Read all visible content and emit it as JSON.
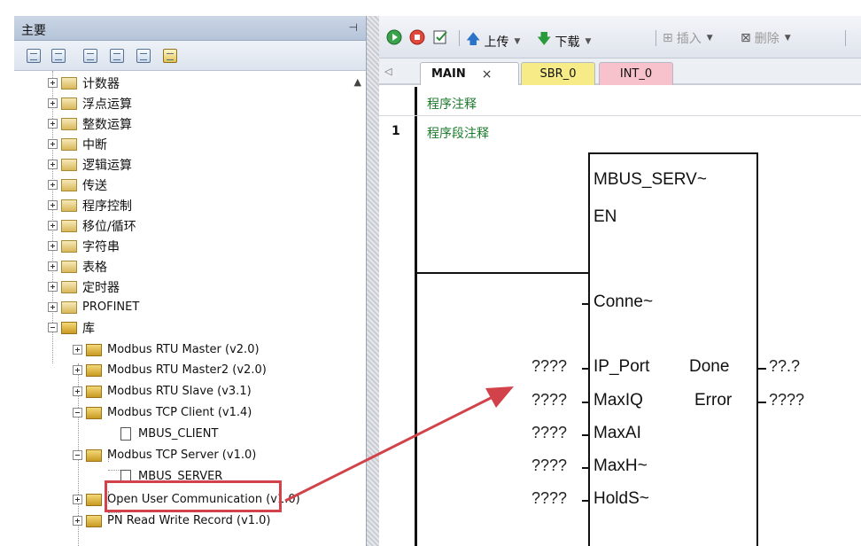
{
  "left_pane": {
    "title": "主要",
    "pin_icon": "pin-icon",
    "toolbar_icons": [
      "view-icon",
      "table-icon",
      "list-icon",
      "list2-icon",
      "details-icon",
      "display-icon"
    ]
  },
  "tree": {
    "items": [
      {
        "label": "计数器",
        "expanded": false
      },
      {
        "label": "浮点运算",
        "expanded": false
      },
      {
        "label": "整数运算",
        "expanded": false
      },
      {
        "label": "中断",
        "expanded": false
      },
      {
        "label": "逻辑运算",
        "expanded": false
      },
      {
        "label": "传送",
        "expanded": false
      },
      {
        "label": "程序控制",
        "expanded": false
      },
      {
        "label": "移位/循环",
        "expanded": false
      },
      {
        "label": "字符串",
        "expanded": false
      },
      {
        "label": "表格",
        "expanded": false
      },
      {
        "label": "定时器",
        "expanded": false
      },
      {
        "label": "PROFINET",
        "expanded": false
      },
      {
        "label": "库",
        "expanded": true
      }
    ],
    "library_items": [
      {
        "label": "Modbus RTU Master (v2.0)",
        "expanded": false
      },
      {
        "label": "Modbus RTU Master2 (v2.0)",
        "expanded": false
      },
      {
        "label": "Modbus RTU Slave (v3.1)",
        "expanded": false
      },
      {
        "label": "Modbus TCP Client (v1.4)",
        "expanded": true
      },
      {
        "label": "MBUS_CLIENT",
        "leaf": true
      },
      {
        "label": "Modbus TCP Server (v1.0)",
        "expanded": true
      },
      {
        "label": "MBUS_SERVER",
        "leaf": true,
        "highlighted": true
      },
      {
        "label": "Open User Communication (v1.0)",
        "expanded": false
      },
      {
        "label": "PN Read Write Record (v1.0)",
        "expanded": false
      }
    ]
  },
  "toolbar": {
    "run_icon": "run-icon",
    "stop_icon": "stop-icon",
    "compile_icon": "compile-icon",
    "upload_label": "上传",
    "download_label": "下载",
    "insert_label": "插入",
    "delete_label": "删除"
  },
  "tabs": {
    "main": "MAIN",
    "close": "×",
    "sbr": "SBR_0",
    "int": "INT_0"
  },
  "editor": {
    "program_comment": "程序注释",
    "segment_number": "1",
    "segment_comment": "程序段注释"
  },
  "function_block": {
    "name": "MBUS_SERV~",
    "en": "EN",
    "inputs": [
      {
        "label": "Conne~",
        "value": ""
      },
      {
        "label": "IP_Port",
        "value": "????"
      },
      {
        "label": "MaxIQ",
        "value": "????"
      },
      {
        "label": "MaxAI",
        "value": "????"
      },
      {
        "label": "MaxH~",
        "value": "????"
      },
      {
        "label": "HoldS~",
        "value": "????"
      }
    ],
    "outputs": [
      {
        "label": "Done",
        "value": "??.?"
      },
      {
        "label": "Error",
        "value": "????"
      }
    ]
  },
  "annotation": {
    "highlight_color": "#d2424a",
    "arrow_color": "#d2424a"
  }
}
